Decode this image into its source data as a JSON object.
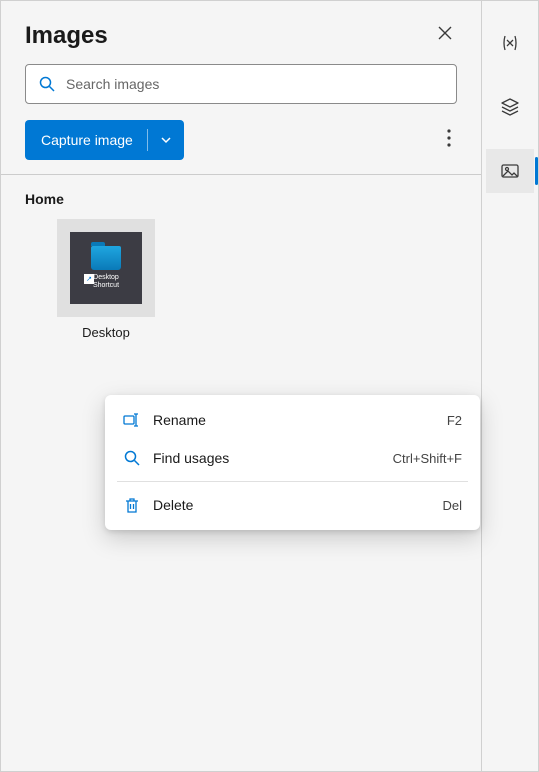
{
  "panel": {
    "title": "Images"
  },
  "search": {
    "placeholder": "Search images"
  },
  "toolbar": {
    "capture_label": "Capture image"
  },
  "section": {
    "title": "Home"
  },
  "items": [
    {
      "label": "Desktop",
      "inner_caption": "Desktop\nShortcut"
    }
  ],
  "context_menu": {
    "items": [
      {
        "label": "Rename",
        "shortcut": "F2",
        "icon": "rename"
      },
      {
        "label": "Find usages",
        "shortcut": "Ctrl+Shift+F",
        "icon": "search"
      },
      {
        "label": "Delete",
        "shortcut": "Del",
        "icon": "delete",
        "separated": true
      }
    ]
  },
  "rail": {
    "items": [
      {
        "name": "variables-icon"
      },
      {
        "name": "layers-icon"
      },
      {
        "name": "images-icon",
        "active": true
      }
    ]
  }
}
